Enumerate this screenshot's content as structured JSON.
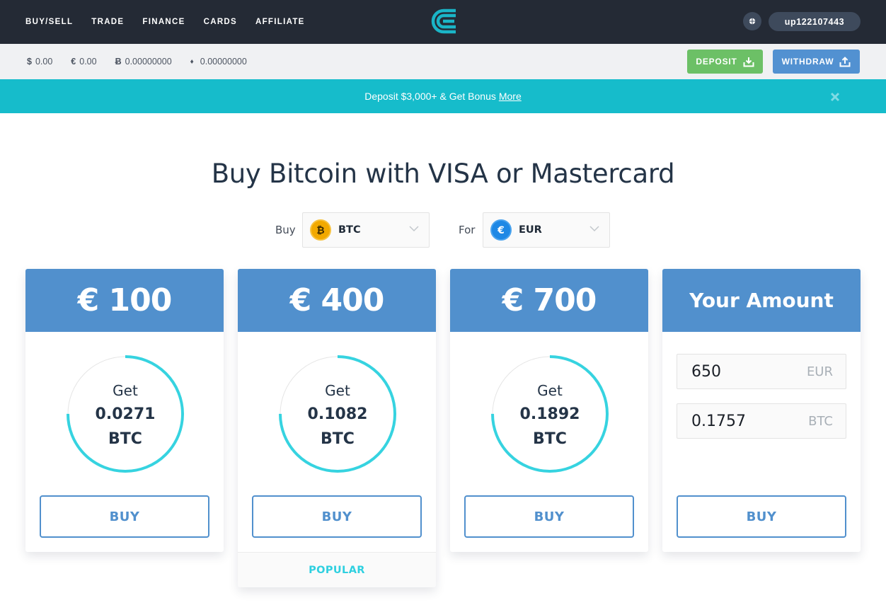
{
  "nav": {
    "links": [
      "BUY/SELL",
      "TRADE",
      "FINANCE",
      "CARDS",
      "AFFILIATE"
    ],
    "logo": "cex-logo",
    "username": "up122107443",
    "globe_icon": "globe-icon"
  },
  "balances": [
    {
      "symbol": "$",
      "value": "0.00"
    },
    {
      "symbol": "€",
      "value": "0.00"
    },
    {
      "symbol": "Ƀ",
      "value": "0.00000000"
    },
    {
      "symbol": "♦",
      "value": "0.00000000"
    }
  ],
  "actions": {
    "deposit": "DEPOSIT",
    "withdraw": "WITHDRAW"
  },
  "promo": {
    "text": "Deposit $3,000+ & Get Bonus",
    "link": "More"
  },
  "title": "Buy Bitcoin with VISA or Mastercard",
  "selectors": {
    "buy_label": "Buy",
    "buy_value": "BTC",
    "for_label": "For",
    "for_value": "EUR"
  },
  "colors": {
    "accent": "#5190cd",
    "teal": "#16bccb",
    "gauge": "#36d3e0",
    "deposit": "#6cc066",
    "nav_bg": "#242a35"
  },
  "cards": [
    {
      "amount": "€ 100",
      "get": "Get",
      "value": "0.0271",
      "unit": "BTC",
      "buy": "BUY",
      "gauge_fraction": 0.75
    },
    {
      "amount": "€ 400",
      "get": "Get",
      "value": "0.1082",
      "unit": "BTC",
      "buy": "BUY",
      "gauge_fraction": 0.75,
      "badge": "POPULAR"
    },
    {
      "amount": "€ 700",
      "get": "Get",
      "value": "0.1892",
      "unit": "BTC",
      "buy": "BUY",
      "gauge_fraction": 0.75
    }
  ],
  "custom": {
    "title": "Your Amount",
    "eur_value": "650",
    "eur_suffix": "EUR",
    "btc_value": "0.1757",
    "btc_suffix": "BTC",
    "buy": "BUY"
  }
}
